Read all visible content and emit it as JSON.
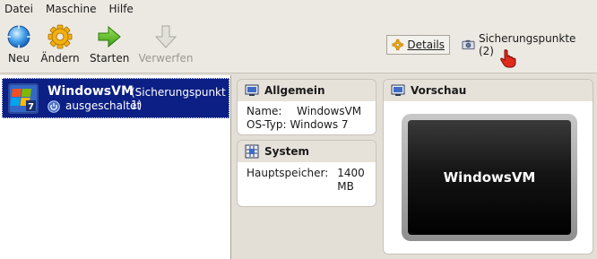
{
  "menu": {
    "items": [
      {
        "label": "Datei"
      },
      {
        "label": "Maschine"
      },
      {
        "label": "Hilfe"
      }
    ]
  },
  "toolbar": {
    "new_label": "Neu",
    "change_label": "Ändern",
    "start_label": "Starten",
    "discard_label": "Verwerfen"
  },
  "view_tabs": {
    "details_label": "Details",
    "snapshots_label": "Sicherungspunkte (2)"
  },
  "vm_list": {
    "items": [
      {
        "name": "WindowsVM",
        "snapshot": "(Sicherungspunkt 1)",
        "state": "ausgeschaltet",
        "os_icon": "windows7-icon",
        "state_icon": "power-off-icon"
      }
    ]
  },
  "details": {
    "general": {
      "title": "Allgemein",
      "name_label": "Name:",
      "name_value": "WindowsVM",
      "ostype_label": "OS-Typ:",
      "ostype_value": "Windows 7"
    },
    "system": {
      "title": "System",
      "memory_label": "Hauptspeicher:",
      "memory_value": "1400 MB"
    },
    "preview": {
      "title": "Vorschau",
      "screen_text": "WindowsVM"
    }
  },
  "colors": {
    "selection": "#0c1f84",
    "background": "#e3ded6",
    "panel_header": "#e6e2da"
  }
}
